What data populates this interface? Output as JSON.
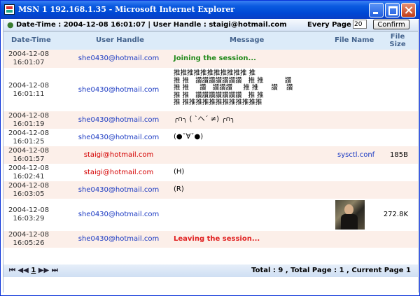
{
  "window": {
    "title": "MSN 1 192.168.1.35 - Microsoft Internet Explorer"
  },
  "header": {
    "info": "Date-Time : 2004-12-08 16:01:07 | User Handle : staigi@hotmail.com",
    "every_page_label": "Every Page :",
    "every_page_value": "20",
    "confirm_label": "Confirm"
  },
  "columns": {
    "date_time": "Date-Time",
    "user_handle": "User Handle",
    "message": "Message",
    "file_name": "File Name",
    "file_size": "File Size"
  },
  "rows": [
    {
      "date": "2004-12-08",
      "time": "16:01:07",
      "user": "she0430@hotmail.com",
      "user_color": "blue",
      "message": "Joining the session...",
      "msg_style": "green",
      "file_name": "",
      "file_size": "",
      "alt": true
    },
    {
      "date": "2004-12-08",
      "time": "16:01:11",
      "user": "she0430@hotmail.com",
      "user_color": "blue",
      "message": "推推推推推推推推推推推 推\n推 推   讚讚讚讚讚讚讚   推 推          讚\n推 推     讚   讚讚讚     推 推      讚    讚\n推 推   讚讚讚讚讚讚讚   推 推\n推 推推推推推推推推推推推推",
      "msg_style": "plain",
      "file_name": "",
      "file_size": "",
      "alt": false
    },
    {
      "date": "2004-12-08",
      "time": "16:01:19",
      "user": "she0430@hotmail.com",
      "user_color": "blue",
      "message": "╭∩╮ ( `へ´ ≠) ╭∩╮",
      "msg_style": "plain",
      "file_name": "",
      "file_size": "",
      "alt": true
    },
    {
      "date": "2004-12-08",
      "time": "16:01:25",
      "user": "she0430@hotmail.com",
      "user_color": "blue",
      "message": "(●ˇ∀ˇ●)",
      "msg_style": "plain",
      "file_name": "",
      "file_size": "",
      "alt": false
    },
    {
      "date": "2004-12-08",
      "time": "16:01:57",
      "user": "staigi@hotmail.com",
      "user_color": "red",
      "message": "",
      "msg_style": "plain",
      "file_name": "sysctl.conf",
      "file_size": "185B",
      "alt": true
    },
    {
      "date": "2004-12-08",
      "time": "16:02:41",
      "user": "staigi@hotmail.com",
      "user_color": "red",
      "message": "(H)",
      "msg_style": "plain",
      "file_name": "",
      "file_size": "",
      "alt": false
    },
    {
      "date": "2004-12-08",
      "time": "16:03:05",
      "user": "she0430@hotmail.com",
      "user_color": "blue",
      "message": "(R)",
      "msg_style": "plain",
      "file_name": "",
      "file_size": "",
      "alt": true
    },
    {
      "date": "2004-12-08",
      "time": "16:03:29",
      "user": "she0430@hotmail.com",
      "user_color": "blue",
      "message": "",
      "msg_style": "plain",
      "file_name": "",
      "file_size": "272.8K",
      "alt": false
    },
    {
      "date": "2004-12-08",
      "time": "16:05:26",
      "user": "she0430@hotmail.com",
      "user_color": "blue",
      "message": "Leaving the session...",
      "msg_style": "redb",
      "file_name": "",
      "file_size": "",
      "alt": true
    }
  ],
  "footer": {
    "first": "⏮",
    "prev": "◀◀",
    "page": "1",
    "next": "▶▶",
    "last": "⏭",
    "total": "Total : 9 , Total Page : 1 , Current Page 1"
  },
  "colors": {
    "title_bar": "#0047d4",
    "link_blue": "#1a39c2",
    "alert_red": "#d40000",
    "join_green": "#228a1c"
  }
}
